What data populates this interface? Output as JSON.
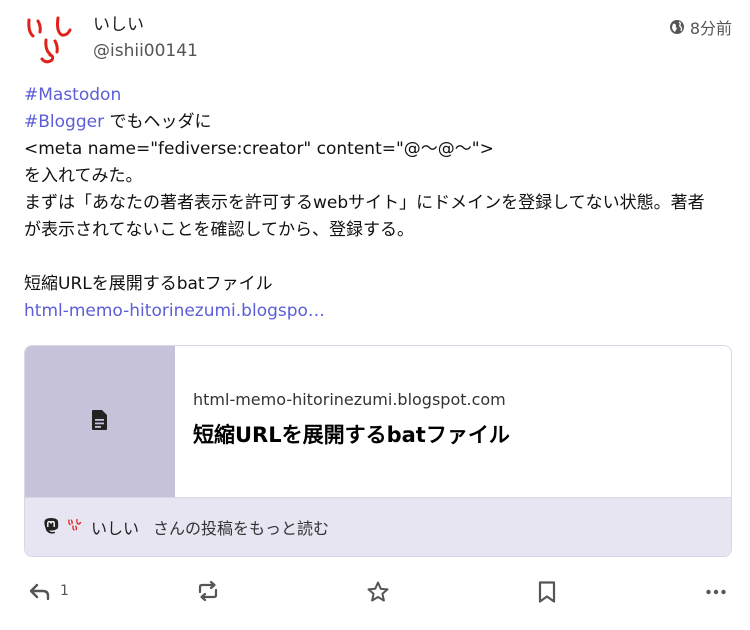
{
  "author": {
    "display_name": "いしい",
    "handle": "@ishii00141",
    "avatar_text": "いしい",
    "avatar_color": "#e0201b"
  },
  "timestamp": {
    "icon": "globe-icon",
    "text": "8分前"
  },
  "content": {
    "hashtag1": "#Mastodon",
    "hashtag2": "#Blogger",
    "line2_rest": " でもヘッダに",
    "line3": "<meta name=\"fediverse:creator\" content=\"@〜@〜\">",
    "line4": "を入れてみた。",
    "line5": "まずは「あなたの著者表示を許可するwebサイト」にドメインを登録してない状態。著者が表示されてないことを確認してから、登録する。",
    "line7": "短縮URLを展開するbatファイル",
    "link": "html-memo-hitorinezumi.blogspo…"
  },
  "card": {
    "thumb_icon": "document-icon",
    "thumb_color": "#c5c2d9",
    "domain": "html-memo-hitorinezumi.blogspot.com",
    "title": "短縮URLを展開するbatファイル",
    "footer": {
      "icon": "mastodon-icon",
      "author": "いしい",
      "text": "さんの投稿をもっと読む"
    }
  },
  "actions": {
    "reply_count": "1",
    "icons": [
      "reply-icon",
      "boost-icon",
      "star-icon",
      "bookmark-icon",
      "more-icon"
    ]
  },
  "colors": {
    "link": "#5b5ed6",
    "card_footer_bg": "#e7e5f1"
  }
}
